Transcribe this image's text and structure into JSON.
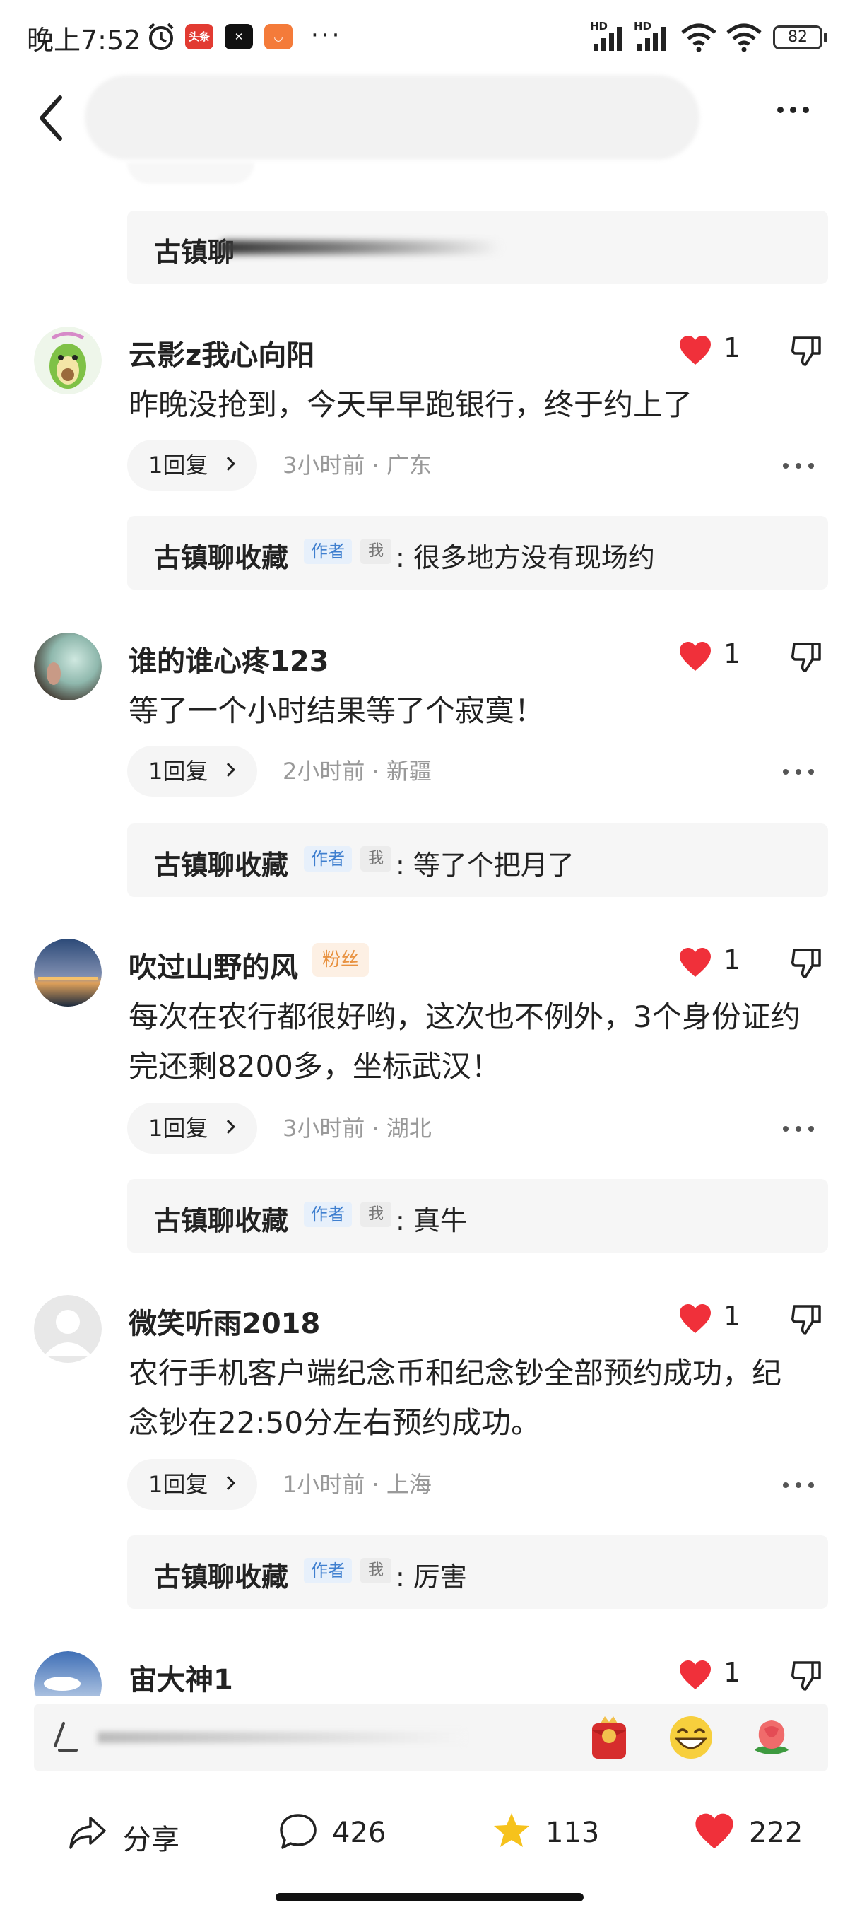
{
  "status_bar": {
    "time": "晚上7:52",
    "battery": "82",
    "app_badge_toutiao": "头条",
    "hd1": "HD",
    "hd2": "HD"
  },
  "reply_prefix_partial": "古镇聊",
  "comments": [
    {
      "user": "云影z我心向阳",
      "likes": "1",
      "text": "昨晚没抢到，今天早早跑银行，终于约上了",
      "reply_label": "1回复",
      "meta": "3小时前 · 广东",
      "reply": {
        "author": "古镇聊收藏",
        "tag_author": "作者",
        "tag_me": "我",
        "text": ": 很多地方没有现场约"
      }
    },
    {
      "user": "谁的谁心疼123",
      "likes": "1",
      "text": "等了一个小时结果等了个寂寞！",
      "reply_label": "1回复",
      "meta": "2小时前 · 新疆",
      "reply": {
        "author": "古镇聊收藏",
        "tag_author": "作者",
        "tag_me": "我",
        "text": ": 等了个把月了"
      }
    },
    {
      "user": "吹过山野的风",
      "badge": "粉丝",
      "likes": "1",
      "text": "每次在农行都很好哟，这次也不例外，3个身份证约完还剩8200多，坐标武汉！",
      "reply_label": "1回复",
      "meta": "3小时前 · 湖北",
      "reply": {
        "author": "古镇聊收藏",
        "tag_author": "作者",
        "tag_me": "我",
        "text": ": 真牛"
      }
    },
    {
      "user": "微笑听雨2018",
      "likes": "1",
      "text": "农行手机客户端纪念币和纪念钞全部预约成功，纪念钞在22:50分左右预约成功。",
      "reply_label": "1回复",
      "meta": "1小时前 · 上海",
      "reply": {
        "author": "古镇聊收藏",
        "tag_author": "作者",
        "tag_me": "我",
        "text": ": 厉害"
      }
    },
    {
      "user": "宙大神1",
      "likes": "1"
    }
  ],
  "bottom_bar": {
    "share_label": "分享",
    "comment_count": "426",
    "favorite_count": "113",
    "like_count": "222"
  },
  "colors": {
    "like_red": "#f0303a",
    "star_yellow": "#f6c21c",
    "author_tag_blue": "#3f7fcf",
    "fan_badge_orange": "#e8913f"
  }
}
